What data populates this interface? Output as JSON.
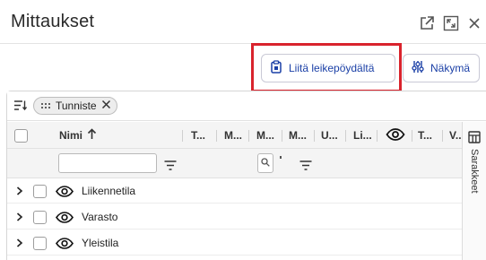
{
  "dialog": {
    "title": "Mittaukset"
  },
  "toolbar": {
    "paste_label": "Liitä leikepöydältä",
    "view_label": "Näkymä"
  },
  "grouping": {
    "chip_label": "Tunniste"
  },
  "columns": {
    "name_header": "Nimi",
    "headers": [
      "T...",
      "M...",
      "M...",
      "M...",
      "U...",
      "Li...",
      "T...",
      "V..."
    ]
  },
  "rows": [
    {
      "label": "Liikennetila"
    },
    {
      "label": "Varasto"
    },
    {
      "label": "Yleistila"
    }
  ],
  "side_panel": {
    "label": "Sarakkeet"
  },
  "colors": {
    "accent": "#1a3fa6",
    "highlight": "#d9232d"
  }
}
